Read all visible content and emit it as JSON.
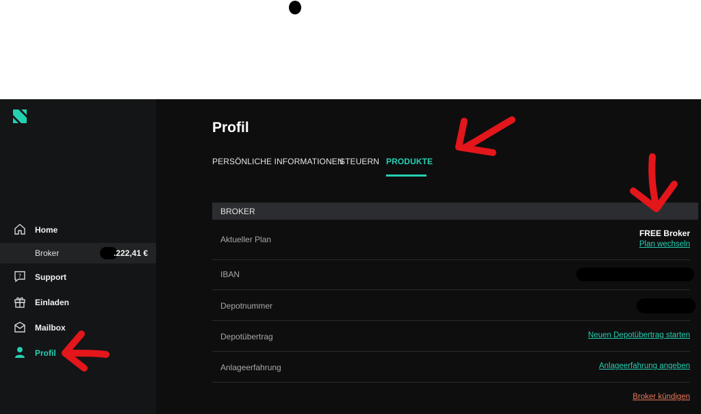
{
  "sidebar": {
    "items": [
      {
        "label": "Home",
        "icon": "home-icon"
      },
      {
        "label": "Broker",
        "amount": ".222,41 €"
      },
      {
        "label": "Support",
        "icon": "question-icon"
      },
      {
        "label": "Einladen",
        "icon": "gift-icon"
      },
      {
        "label": "Mailbox",
        "icon": "mail-icon"
      },
      {
        "label": "Profil",
        "icon": "user-icon"
      }
    ]
  },
  "main": {
    "title": "Profil",
    "tabs": [
      {
        "label": "PERSÖNLICHE INFORMATIONEN"
      },
      {
        "label": "STEUERN"
      },
      {
        "label": "PRODUKTE",
        "active": true
      }
    ],
    "section": {
      "title": "BROKER",
      "rows": {
        "plan": {
          "label": "Aktueller Plan",
          "value": "FREE Broker",
          "link": "Plan wechseln"
        },
        "iban": {
          "label": "IBAN"
        },
        "depot": {
          "label": "Depotnummer"
        },
        "transfer": {
          "label": "Depotübertrag",
          "link": "Neuen Depotübertrag starten"
        },
        "experience": {
          "label": "Anlageerfahrung",
          "link": "Anlageerfahrung angeben"
        },
        "cancel": {
          "link": "Broker kündigen"
        }
      }
    }
  },
  "colors": {
    "accent": "#25d0b1",
    "danger": "#e8785a",
    "annotation": "#e3161b"
  }
}
